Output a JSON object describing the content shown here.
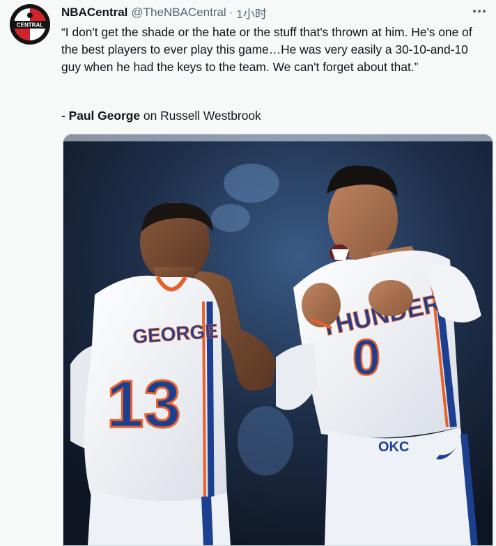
{
  "tweet": {
    "author_name": "NBACentral",
    "author_handle": "@TheNBACentral",
    "separator": "·",
    "timestamp": "1小时",
    "text": "“I don't get the shade or the hate or the stuff that's thrown at him. He's one of the best players to ever play this game…He was very easily a 30-10-and-10 guy when he had the keys to the team. We can't forget about that.”",
    "attribution_prefix": "- ",
    "attribution_name": "Paul George",
    "attribution_suffix": " on Russell Westbrook",
    "avatar_text": "CENTRAL"
  },
  "photo": {
    "left_jersey_name": "GEORGE",
    "left_jersey_number": "13",
    "right_jersey_name": "THUNDER",
    "right_jersey_number": "0",
    "right_shorts_text": "OKC"
  },
  "colors": {
    "background": "#f7f9f9",
    "text": "#0f1419",
    "secondary": "#536471",
    "jersey_blue": "#1d3f8f",
    "jersey_orange": "#e8602c"
  }
}
